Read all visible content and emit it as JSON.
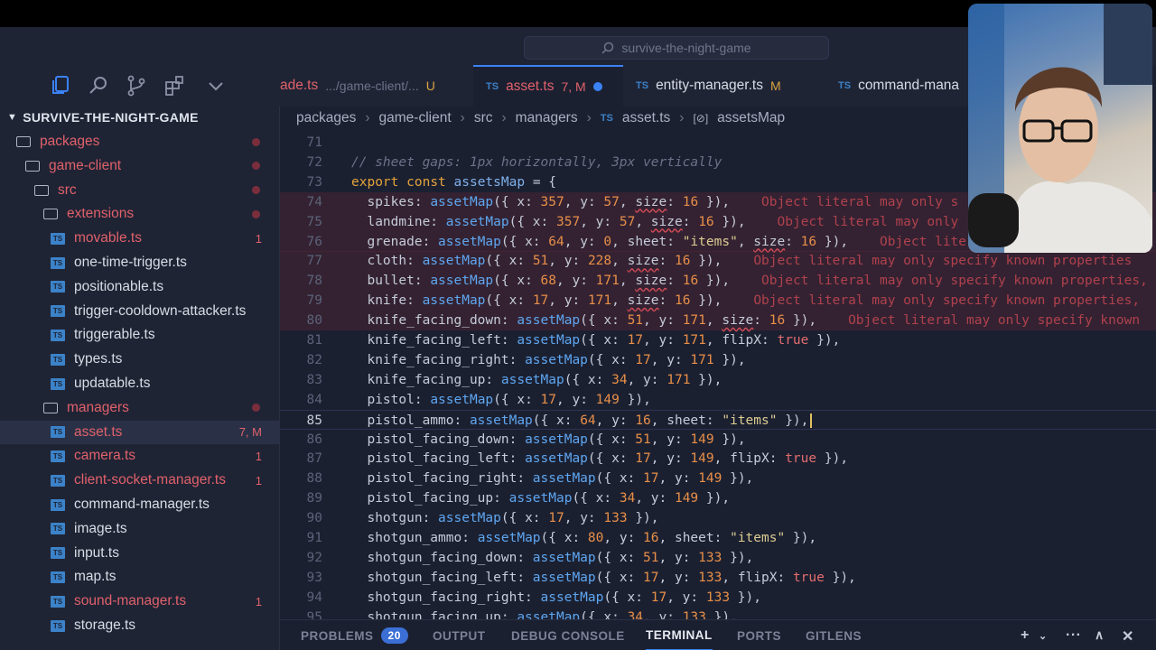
{
  "command_center": {
    "search_text": "survive-the-night-game"
  },
  "explorer": {
    "title": "SURVIVE-THE-NIGHT-GAME",
    "rows": [
      {
        "label": "packages",
        "kind": "folder",
        "badge": "",
        "dot": true,
        "color": "red"
      },
      {
        "label": "game-client",
        "kind": "folder",
        "badge": "",
        "dot": true,
        "color": "red"
      },
      {
        "label": "src",
        "kind": "folder",
        "badge": "",
        "dot": true,
        "color": "red"
      },
      {
        "label": "extensions",
        "kind": "folder",
        "badge": "",
        "dot": true,
        "color": "red"
      },
      {
        "label": "movable.ts",
        "kind": "ts",
        "badge": "1",
        "dot": false,
        "color": "red"
      },
      {
        "label": "one-time-trigger.ts",
        "kind": "ts",
        "badge": "",
        "dot": false,
        "color": "white"
      },
      {
        "label": "positionable.ts",
        "kind": "ts",
        "badge": "",
        "dot": false,
        "color": "white"
      },
      {
        "label": "trigger-cooldown-attacker.ts",
        "kind": "ts",
        "badge": "",
        "dot": false,
        "color": "white"
      },
      {
        "label": "triggerable.ts",
        "kind": "ts",
        "badge": "",
        "dot": false,
        "color": "white"
      },
      {
        "label": "types.ts",
        "kind": "ts",
        "badge": "",
        "dot": false,
        "color": "white"
      },
      {
        "label": "updatable.ts",
        "kind": "ts",
        "badge": "",
        "dot": false,
        "color": "white"
      },
      {
        "label": "managers",
        "kind": "folder",
        "badge": "",
        "dot": true,
        "color": "red"
      },
      {
        "label": "asset.ts",
        "kind": "ts",
        "badge": "7, M",
        "dot": false,
        "color": "red"
      },
      {
        "label": "camera.ts",
        "kind": "ts",
        "badge": "1",
        "dot": false,
        "color": "red"
      },
      {
        "label": "client-socket-manager.ts",
        "kind": "ts",
        "badge": "1",
        "dot": false,
        "color": "red"
      },
      {
        "label": "command-manager.ts",
        "kind": "ts",
        "badge": "",
        "dot": false,
        "color": "white"
      },
      {
        "label": "image.ts",
        "kind": "ts",
        "badge": "",
        "dot": false,
        "color": "white"
      },
      {
        "label": "input.ts",
        "kind": "ts",
        "badge": "",
        "dot": false,
        "color": "white"
      },
      {
        "label": "map.ts",
        "kind": "ts",
        "badge": "",
        "dot": false,
        "color": "white"
      },
      {
        "label": "sound-manager.ts",
        "kind": "ts",
        "badge": "1",
        "dot": false,
        "color": "red"
      },
      {
        "label": "storage.ts",
        "kind": "ts",
        "badge": "",
        "dot": false,
        "color": "white"
      }
    ]
  },
  "tabs": [
    {
      "label": "ade.ts",
      "path": ".../game-client/...",
      "status": "U",
      "active": false
    },
    {
      "label": "asset.ts",
      "path": "",
      "status": "7, M",
      "active": true
    },
    {
      "label": "entity-manager.ts",
      "path": "",
      "status": "M",
      "active": false
    },
    {
      "label": "command-mana",
      "path": "",
      "status": "",
      "active": false
    }
  ],
  "breadcrumb": [
    "packages",
    "game-client",
    "src",
    "managers",
    "asset.ts",
    "assetsMap"
  ],
  "editor": {
    "lines": [
      {
        "num": "71",
        "err": false,
        "tokens": []
      },
      {
        "num": "72",
        "err": false,
        "tokens": [
          [
            "c",
            "// sheet gaps: 1px horizontally, 3px vertically"
          ]
        ]
      },
      {
        "num": "73",
        "err": false,
        "tokens": [
          [
            "k",
            "export"
          ],
          [
            "p",
            " "
          ],
          [
            "k",
            "const"
          ],
          [
            "p",
            " "
          ],
          [
            "v",
            "assetsMap"
          ],
          [
            "p",
            " = {"
          ]
        ]
      },
      {
        "num": "74",
        "err": true,
        "msg": "Object literal may only s",
        "tokens": [
          [
            "p",
            "  spikes: "
          ],
          [
            "f",
            "assetMap"
          ],
          [
            "p",
            "({ x: "
          ],
          [
            "n",
            "357"
          ],
          [
            "p",
            ", y: "
          ],
          [
            "n",
            "57"
          ],
          [
            "p",
            ", "
          ],
          [
            "sq",
            "size"
          ],
          [
            "p",
            ": "
          ],
          [
            "n",
            "16"
          ],
          [
            "p",
            " }),"
          ]
        ]
      },
      {
        "num": "75",
        "err": true,
        "msg": "Object literal may only",
        "tokens": [
          [
            "p",
            "  landmine: "
          ],
          [
            "f",
            "assetMap"
          ],
          [
            "p",
            "({ x: "
          ],
          [
            "n",
            "357"
          ],
          [
            "p",
            ", y: "
          ],
          [
            "n",
            "57"
          ],
          [
            "p",
            ", "
          ],
          [
            "sq",
            "size"
          ],
          [
            "p",
            ": "
          ],
          [
            "n",
            "16"
          ],
          [
            "p",
            " }),"
          ]
        ]
      },
      {
        "num": "76",
        "err": true,
        "msg": "Object lite",
        "tokens": [
          [
            "p",
            "  grenade: "
          ],
          [
            "f",
            "assetMap"
          ],
          [
            "p",
            "({ x: "
          ],
          [
            "n",
            "64"
          ],
          [
            "p",
            ", y: "
          ],
          [
            "n",
            "0"
          ],
          [
            "p",
            ", sheet: "
          ],
          [
            "s",
            "\"items\""
          ],
          [
            "p",
            ", "
          ],
          [
            "sq",
            "size"
          ],
          [
            "p",
            ": "
          ],
          [
            "n",
            "16"
          ],
          [
            "p",
            " }),"
          ]
        ]
      },
      {
        "num": "77",
        "err": true,
        "msg": "Object literal may only specify known properties",
        "tokens": [
          [
            "p",
            "  cloth: "
          ],
          [
            "f",
            "assetMap"
          ],
          [
            "p",
            "({ x: "
          ],
          [
            "n",
            "51"
          ],
          [
            "p",
            ", y: "
          ],
          [
            "n",
            "228"
          ],
          [
            "p",
            ", "
          ],
          [
            "sq",
            "size"
          ],
          [
            "p",
            ": "
          ],
          [
            "n",
            "16"
          ],
          [
            "p",
            " }),"
          ]
        ]
      },
      {
        "num": "78",
        "err": true,
        "msg": "Object literal may only specify known properties,",
        "tokens": [
          [
            "p",
            "  bullet: "
          ],
          [
            "f",
            "assetMap"
          ],
          [
            "p",
            "({ x: "
          ],
          [
            "n",
            "68"
          ],
          [
            "p",
            ", y: "
          ],
          [
            "n",
            "171"
          ],
          [
            "p",
            ", "
          ],
          [
            "sq",
            "size"
          ],
          [
            "p",
            ": "
          ],
          [
            "n",
            "16"
          ],
          [
            "p",
            " }),"
          ]
        ]
      },
      {
        "num": "79",
        "err": true,
        "msg": "Object literal may only specify known properties,",
        "tokens": [
          [
            "p",
            "  knife: "
          ],
          [
            "f",
            "assetMap"
          ],
          [
            "p",
            "({ x: "
          ],
          [
            "n",
            "17"
          ],
          [
            "p",
            ", y: "
          ],
          [
            "n",
            "171"
          ],
          [
            "p",
            ", "
          ],
          [
            "sq",
            "size"
          ],
          [
            "p",
            ": "
          ],
          [
            "n",
            "16"
          ],
          [
            "p",
            " }),"
          ]
        ]
      },
      {
        "num": "80",
        "err": true,
        "msg": "Object literal may only specify known",
        "tokens": [
          [
            "p",
            "  knife_facing_down: "
          ],
          [
            "f",
            "assetMap"
          ],
          [
            "p",
            "({ x: "
          ],
          [
            "n",
            "51"
          ],
          [
            "p",
            ", y: "
          ],
          [
            "n",
            "171"
          ],
          [
            "p",
            ", "
          ],
          [
            "sq",
            "size"
          ],
          [
            "p",
            ": "
          ],
          [
            "n",
            "16"
          ],
          [
            "p",
            " }),"
          ]
        ]
      },
      {
        "num": "81",
        "err": false,
        "tokens": [
          [
            "p",
            "  knife_facing_left: "
          ],
          [
            "f",
            "assetMap"
          ],
          [
            "p",
            "({ x: "
          ],
          [
            "n",
            "17"
          ],
          [
            "p",
            ", y: "
          ],
          [
            "n",
            "171"
          ],
          [
            "p",
            ", flipX: "
          ],
          [
            "b",
            "true"
          ],
          [
            "p",
            " }),"
          ]
        ]
      },
      {
        "num": "82",
        "err": false,
        "tokens": [
          [
            "p",
            "  knife_facing_right: "
          ],
          [
            "f",
            "assetMap"
          ],
          [
            "p",
            "({ x: "
          ],
          [
            "n",
            "17"
          ],
          [
            "p",
            ", y: "
          ],
          [
            "n",
            "171"
          ],
          [
            "p",
            " }),"
          ]
        ]
      },
      {
        "num": "83",
        "err": false,
        "tokens": [
          [
            "p",
            "  knife_facing_up: "
          ],
          [
            "f",
            "assetMap"
          ],
          [
            "p",
            "({ x: "
          ],
          [
            "n",
            "34"
          ],
          [
            "p",
            ", y: "
          ],
          [
            "n",
            "171"
          ],
          [
            "p",
            " }),"
          ]
        ]
      },
      {
        "num": "84",
        "err": false,
        "tokens": [
          [
            "p",
            "  pistol: "
          ],
          [
            "f",
            "assetMap"
          ],
          [
            "p",
            "({ x: "
          ],
          [
            "n",
            "17"
          ],
          [
            "p",
            ", y: "
          ],
          [
            "n",
            "149"
          ],
          [
            "p",
            " }),"
          ]
        ]
      },
      {
        "num": "85",
        "err": false,
        "current": true,
        "tokens": [
          [
            "p",
            "  pistol_ammo: "
          ],
          [
            "f",
            "assetMap"
          ],
          [
            "p",
            "({ x: "
          ],
          [
            "n",
            "64"
          ],
          [
            "p",
            ", y: "
          ],
          [
            "n",
            "16"
          ],
          [
            "p",
            ", sheet: "
          ],
          [
            "s",
            "\"items\""
          ],
          [
            "p",
            " }),"
          ]
        ]
      },
      {
        "num": "86",
        "err": false,
        "tokens": [
          [
            "p",
            "  pistol_facing_down: "
          ],
          [
            "f",
            "assetMap"
          ],
          [
            "p",
            "({ x: "
          ],
          [
            "n",
            "51"
          ],
          [
            "p",
            ", y: "
          ],
          [
            "n",
            "149"
          ],
          [
            "p",
            " }),"
          ]
        ]
      },
      {
        "num": "87",
        "err": false,
        "tokens": [
          [
            "p",
            "  pistol_facing_left: "
          ],
          [
            "f",
            "assetMap"
          ],
          [
            "p",
            "({ x: "
          ],
          [
            "n",
            "17"
          ],
          [
            "p",
            ", y: "
          ],
          [
            "n",
            "149"
          ],
          [
            "p",
            ", flipX: "
          ],
          [
            "b",
            "true"
          ],
          [
            "p",
            " }),"
          ]
        ]
      },
      {
        "num": "88",
        "err": false,
        "tokens": [
          [
            "p",
            "  pistol_facing_right: "
          ],
          [
            "f",
            "assetMap"
          ],
          [
            "p",
            "({ x: "
          ],
          [
            "n",
            "17"
          ],
          [
            "p",
            ", y: "
          ],
          [
            "n",
            "149"
          ],
          [
            "p",
            " }),"
          ]
        ]
      },
      {
        "num": "89",
        "err": false,
        "tokens": [
          [
            "p",
            "  pistol_facing_up: "
          ],
          [
            "f",
            "assetMap"
          ],
          [
            "p",
            "({ x: "
          ],
          [
            "n",
            "34"
          ],
          [
            "p",
            ", y: "
          ],
          [
            "n",
            "149"
          ],
          [
            "p",
            " }),"
          ]
        ]
      },
      {
        "num": "90",
        "err": false,
        "tokens": [
          [
            "p",
            "  shotgun: "
          ],
          [
            "f",
            "assetMap"
          ],
          [
            "p",
            "({ x: "
          ],
          [
            "n",
            "17"
          ],
          [
            "p",
            ", y: "
          ],
          [
            "n",
            "133"
          ],
          [
            "p",
            " }),"
          ]
        ]
      },
      {
        "num": "91",
        "err": false,
        "tokens": [
          [
            "p",
            "  shotgun_ammo: "
          ],
          [
            "f",
            "assetMap"
          ],
          [
            "p",
            "({ x: "
          ],
          [
            "n",
            "80"
          ],
          [
            "p",
            ", y: "
          ],
          [
            "n",
            "16"
          ],
          [
            "p",
            ", sheet: "
          ],
          [
            "s",
            "\"items\""
          ],
          [
            "p",
            " }),"
          ]
        ]
      },
      {
        "num": "92",
        "err": false,
        "tokens": [
          [
            "p",
            "  shotgun_facing_down: "
          ],
          [
            "f",
            "assetMap"
          ],
          [
            "p",
            "({ x: "
          ],
          [
            "n",
            "51"
          ],
          [
            "p",
            ", y: "
          ],
          [
            "n",
            "133"
          ],
          [
            "p",
            " }),"
          ]
        ]
      },
      {
        "num": "93",
        "err": false,
        "tokens": [
          [
            "p",
            "  shotgun_facing_left: "
          ],
          [
            "f",
            "assetMap"
          ],
          [
            "p",
            "({ x: "
          ],
          [
            "n",
            "17"
          ],
          [
            "p",
            ", y: "
          ],
          [
            "n",
            "133"
          ],
          [
            "p",
            ", flipX: "
          ],
          [
            "b",
            "true"
          ],
          [
            "p",
            " }),"
          ]
        ]
      },
      {
        "num": "94",
        "err": false,
        "tokens": [
          [
            "p",
            "  shotgun_facing_right: "
          ],
          [
            "f",
            "assetMap"
          ],
          [
            "p",
            "({ x: "
          ],
          [
            "n",
            "17"
          ],
          [
            "p",
            ", y: "
          ],
          [
            "n",
            "133"
          ],
          [
            "p",
            " }),"
          ]
        ]
      },
      {
        "num": "95",
        "err": false,
        "tokens": [
          [
            "p",
            "  shotgun_facing_up: "
          ],
          [
            "f",
            "assetMap"
          ],
          [
            "p",
            "({ x: "
          ],
          [
            "n",
            "34"
          ],
          [
            "p",
            ", y: "
          ],
          [
            "n",
            "133"
          ],
          [
            "p",
            " }),"
          ]
        ]
      }
    ]
  },
  "panel": {
    "tabs": [
      {
        "label": "PROBLEMS",
        "count": "20",
        "active": false
      },
      {
        "label": "OUTPUT",
        "count": "",
        "active": false
      },
      {
        "label": "DEBUG CONSOLE",
        "count": "",
        "active": false
      },
      {
        "label": "TERMINAL",
        "count": "",
        "active": true
      },
      {
        "label": "PORTS",
        "count": "",
        "active": false
      },
      {
        "label": "GITLENS",
        "count": "",
        "active": false
      }
    ]
  },
  "icons": {
    "activity": [
      "files-icon",
      "search-icon",
      "source-control-icon",
      "extensions-icon",
      "chevron-down-icon"
    ],
    "panel_actions": [
      "add-terminal-icon",
      "more-icon",
      "maximize-icon",
      "close-icon"
    ]
  },
  "colors": {
    "accent": "#3b82f6",
    "error": "#e0616a",
    "ts_badge": "#3b82c8"
  }
}
